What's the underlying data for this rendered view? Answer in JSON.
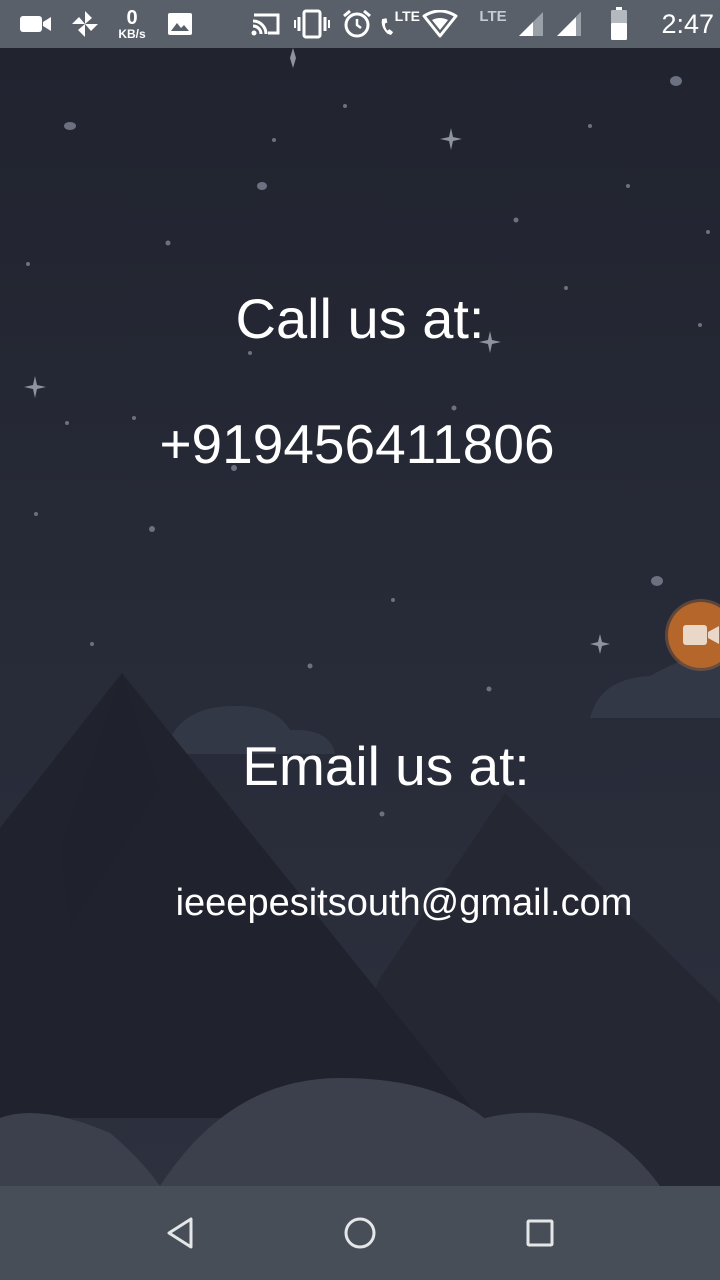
{
  "status_bar": {
    "network_speed_value": "0",
    "network_speed_unit": "KB/s",
    "lte_label_1": "LTE",
    "lte_label_2": "LTE",
    "time": "2:47",
    "icons": [
      "video-camera-icon",
      "pinwheel-icon",
      "image-icon",
      "cast-icon",
      "vibrate-icon",
      "alarm-icon",
      "wifi-calling-lte-icon",
      "wifi-icon",
      "signal-icon",
      "signal-icon",
      "battery-icon"
    ]
  },
  "contact": {
    "call_heading": "Call us at:",
    "phone_number": "+919456411806",
    "email_heading": "Email us at:",
    "email_address": "ieeepesitsouth@gmail.com"
  },
  "floating_button": {
    "icon": "video-camera-icon",
    "color": "#b5662a"
  },
  "nav_bar": {
    "icons": [
      "back-icon",
      "home-icon",
      "recents-icon"
    ]
  },
  "colors": {
    "background": "#262a36",
    "status_bar": "#596069",
    "nav_bar": "#474e58",
    "text": "#ffffff"
  }
}
